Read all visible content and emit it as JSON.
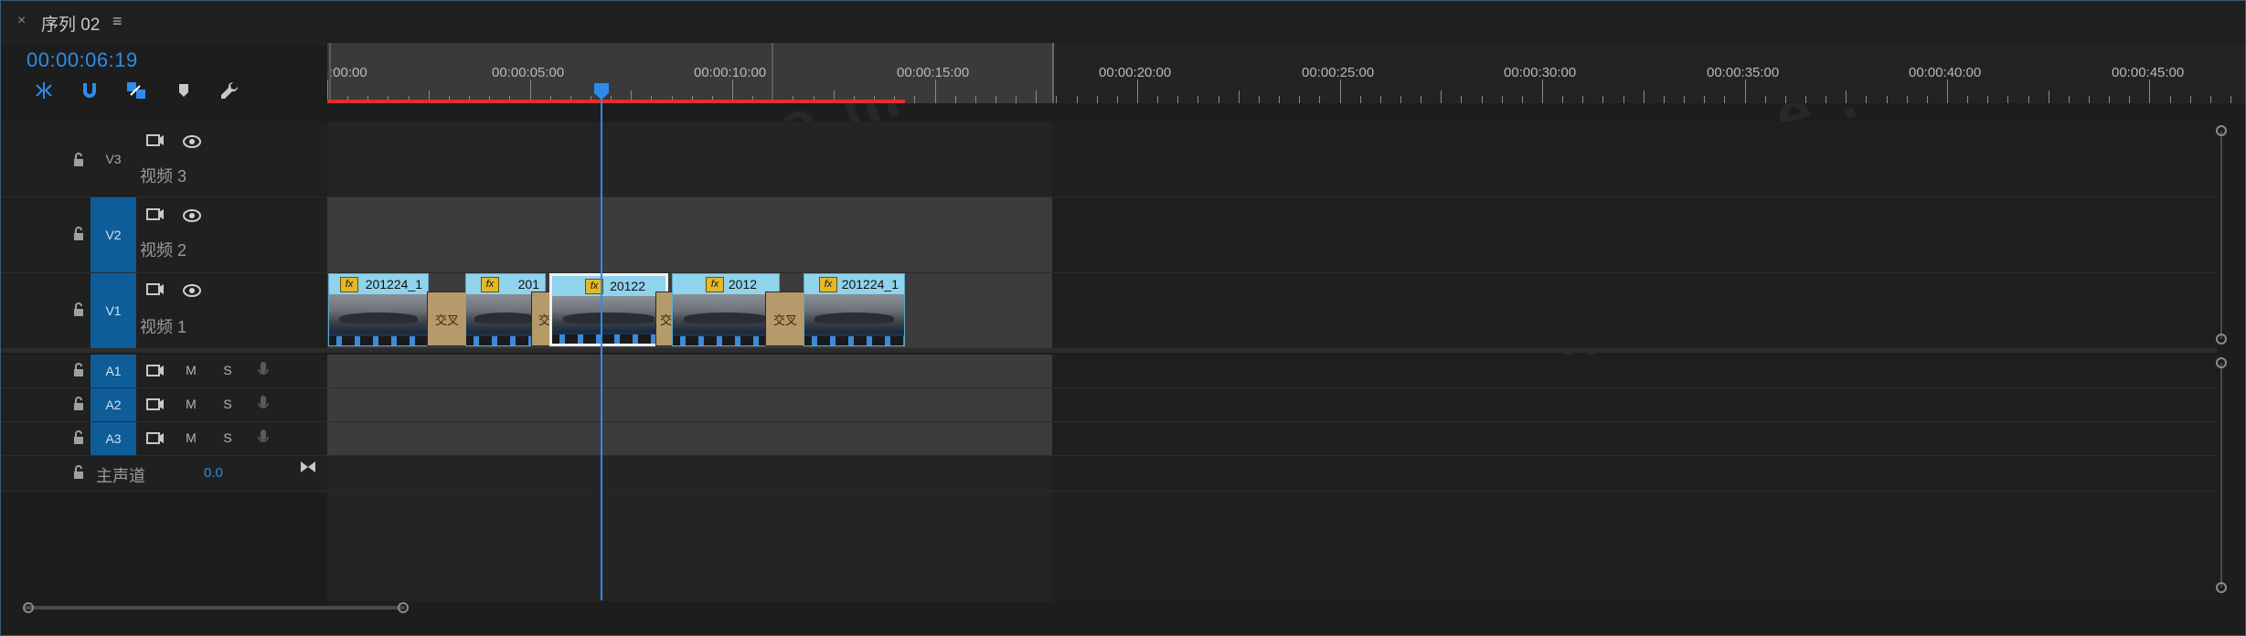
{
  "panel": {
    "close_label": "×",
    "title": "序列 02",
    "menu_label": "≡"
  },
  "timecode": "00:00:06:19",
  "tools": [
    {
      "name": "nest-sequence-icon"
    },
    {
      "name": "snap-icon"
    },
    {
      "name": "linked-selection-icon"
    },
    {
      "name": "add-marker-icon"
    },
    {
      "name": "settings-wrench-icon"
    }
  ],
  "ruler": {
    "labels": [
      ":00:00",
      "00:00:05:00",
      "00:00:10:00",
      "00:00:15:00",
      "00:00:20:00",
      "00:00:25:00",
      "00:00:30:00",
      "00:00:35:00",
      "00:00:40:00",
      "00:00:45:00"
    ]
  },
  "video_tracks": [
    {
      "id": "V3",
      "name": "视频 3",
      "targeted": false
    },
    {
      "id": "V2",
      "name": "视频 2",
      "targeted": true
    },
    {
      "id": "V1",
      "name": "视频 1",
      "targeted": true
    }
  ],
  "audio_tracks": [
    {
      "id": "A1",
      "mute": "M",
      "solo": "S"
    },
    {
      "id": "A2",
      "mute": "M",
      "solo": "S"
    },
    {
      "id": "A3",
      "mute": "M",
      "solo": "S"
    }
  ],
  "master": {
    "name": "主声道",
    "value": "0.0"
  },
  "clips": [
    {
      "name": "201224_1",
      "selected": false
    },
    {
      "name": "201",
      "selected": false
    },
    {
      "name": "20122",
      "selected": true
    },
    {
      "name": "2012",
      "selected": false
    },
    {
      "name": "201224_1",
      "selected": false
    }
  ],
  "transition_label": "交叉",
  "watermark_text": "wasee.com",
  "colors": {
    "accent": "#2d8ceb",
    "target_track": "#0e5d99",
    "clip_label": "#8fd3ec",
    "work_area_red": "#e0302a",
    "fx_badge": "#e3b92a"
  }
}
